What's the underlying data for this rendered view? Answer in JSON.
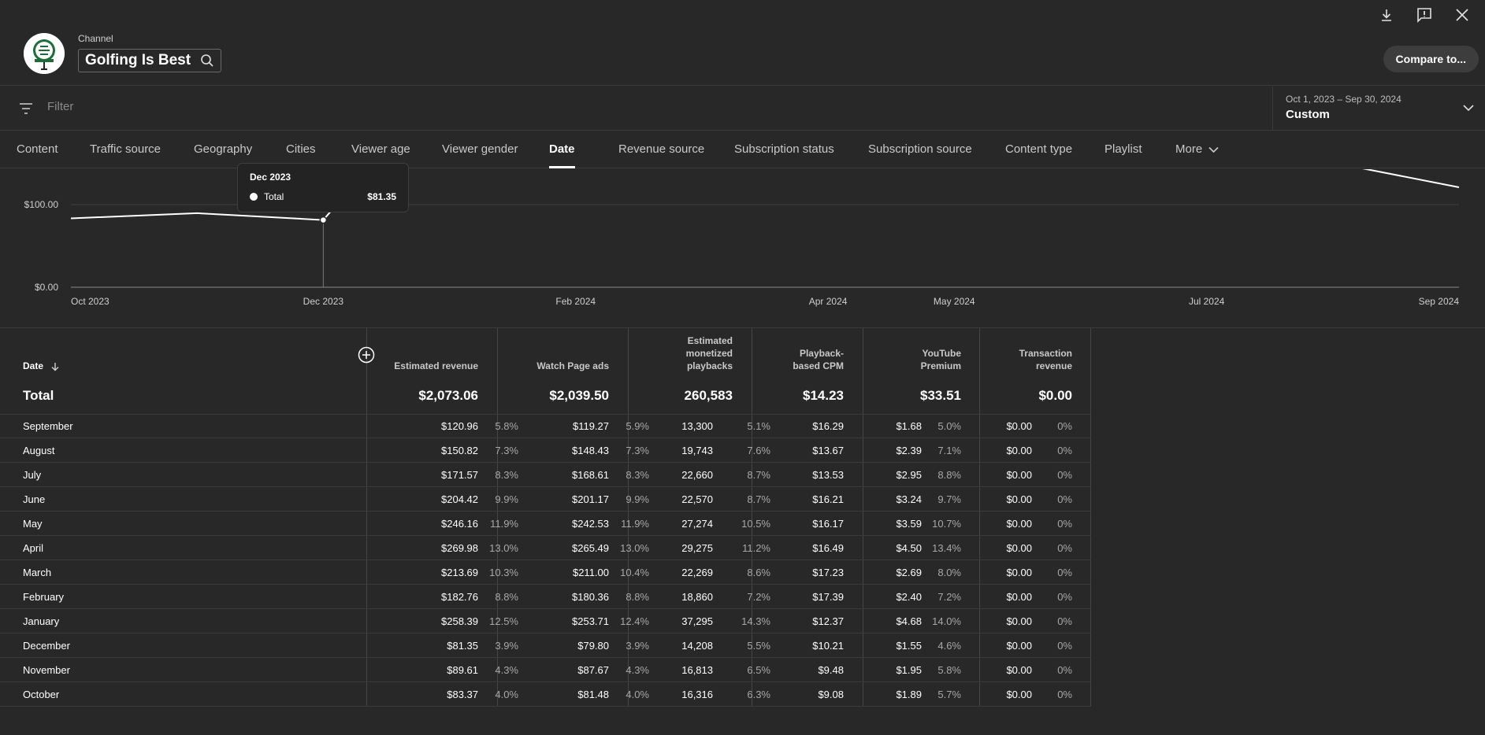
{
  "header": {
    "channel_label": "Channel",
    "channel_name": "Golfing Is Best",
    "compare_label": "Compare to..."
  },
  "filter": {
    "placeholder": "Filter",
    "date_range": "Oct 1, 2023 – Sep 30, 2024",
    "date_preset": "Custom"
  },
  "tabs": [
    {
      "label": "Content"
    },
    {
      "label": "Traffic source"
    },
    {
      "label": "Geography"
    },
    {
      "label": "Cities"
    },
    {
      "label": "Viewer age"
    },
    {
      "label": "Viewer gender"
    },
    {
      "label": "Date"
    },
    {
      "label": "Revenue source"
    },
    {
      "label": "Subscription status"
    },
    {
      "label": "Subscription source"
    },
    {
      "label": "Content type"
    },
    {
      "label": "Playlist"
    },
    {
      "label": "More"
    }
  ],
  "active_tab": "Date",
  "tooltip": {
    "date": "Dec 2023",
    "series": "Total",
    "value": "$81.35"
  },
  "chart_data": {
    "type": "line",
    "x": [
      "Oct 2023",
      "Nov 2023",
      "Dec 2023",
      "Jan 2024",
      "Feb 2024",
      "Mar 2024",
      "Apr 2024",
      "May 2024",
      "Jun 2024",
      "Jul 2024",
      "Aug 2024",
      "Sep 2024"
    ],
    "x_tick_labels": [
      "Oct 2023",
      "Dec 2023",
      "Feb 2024",
      "Apr 2024",
      "May 2024",
      "Jul 2024",
      "Sep 2024"
    ],
    "y_tick_labels": [
      "$100.00",
      "$0.00"
    ],
    "series": [
      {
        "name": "Total",
        "values": [
          83.37,
          89.61,
          81.35,
          258.39,
          182.76,
          213.69,
          269.98,
          246.16,
          204.42,
          171.57,
          150.82,
          120.96
        ]
      }
    ],
    "ylim": [
      0,
      120
    ],
    "highlight_x": "Dec 2023",
    "colors": {
      "line": "#ffffff",
      "grid": "#3e3e3e",
      "axis": "#9a9a9a"
    }
  },
  "table": {
    "date_header": "Date",
    "columns": [
      {
        "label": "Estimated revenue"
      },
      {
        "label": "Watch Page ads"
      },
      {
        "label": "Estimated monetized playbacks"
      },
      {
        "label": "Playback-based CPM"
      },
      {
        "label": "YouTube Premium"
      },
      {
        "label": "Transaction revenue"
      }
    ],
    "total_label": "Total",
    "totals": [
      "$2,073.06",
      "$2,039.50",
      "260,583",
      "$14.23",
      "$33.51",
      "$0.00"
    ],
    "rows": [
      {
        "label": "September",
        "rev": "$120.96",
        "rev_pct": "5.8%",
        "ads": "$119.27",
        "ads_pct": "5.9%",
        "mp": "13,300",
        "mp_pct": "5.1%",
        "cpm": "$16.29",
        "prem": "$1.68",
        "prem_pct": "5.0%",
        "tr": "$0.00",
        "tr_pct": "0%"
      },
      {
        "label": "August",
        "rev": "$150.82",
        "rev_pct": "7.3%",
        "ads": "$148.43",
        "ads_pct": "7.3%",
        "mp": "19,743",
        "mp_pct": "7.6%",
        "cpm": "$13.67",
        "prem": "$2.39",
        "prem_pct": "7.1%",
        "tr": "$0.00",
        "tr_pct": "0%"
      },
      {
        "label": "July",
        "rev": "$171.57",
        "rev_pct": "8.3%",
        "ads": "$168.61",
        "ads_pct": "8.3%",
        "mp": "22,660",
        "mp_pct": "8.7%",
        "cpm": "$13.53",
        "prem": "$2.95",
        "prem_pct": "8.8%",
        "tr": "$0.00",
        "tr_pct": "0%"
      },
      {
        "label": "June",
        "rev": "$204.42",
        "rev_pct": "9.9%",
        "ads": "$201.17",
        "ads_pct": "9.9%",
        "mp": "22,570",
        "mp_pct": "8.7%",
        "cpm": "$16.21",
        "prem": "$3.24",
        "prem_pct": "9.7%",
        "tr": "$0.00",
        "tr_pct": "0%"
      },
      {
        "label": "May",
        "rev": "$246.16",
        "rev_pct": "11.9%",
        "ads": "$242.53",
        "ads_pct": "11.9%",
        "mp": "27,274",
        "mp_pct": "10.5%",
        "cpm": "$16.17",
        "prem": "$3.59",
        "prem_pct": "10.7%",
        "tr": "$0.00",
        "tr_pct": "0%"
      },
      {
        "label": "April",
        "rev": "$269.98",
        "rev_pct": "13.0%",
        "ads": "$265.49",
        "ads_pct": "13.0%",
        "mp": "29,275",
        "mp_pct": "11.2%",
        "cpm": "$16.49",
        "prem": "$4.50",
        "prem_pct": "13.4%",
        "tr": "$0.00",
        "tr_pct": "0%"
      },
      {
        "label": "March",
        "rev": "$213.69",
        "rev_pct": "10.3%",
        "ads": "$211.00",
        "ads_pct": "10.4%",
        "mp": "22,269",
        "mp_pct": "8.6%",
        "cpm": "$17.23",
        "prem": "$2.69",
        "prem_pct": "8.0%",
        "tr": "$0.00",
        "tr_pct": "0%"
      },
      {
        "label": "February",
        "rev": "$182.76",
        "rev_pct": "8.8%",
        "ads": "$180.36",
        "ads_pct": "8.8%",
        "mp": "18,860",
        "mp_pct": "7.2%",
        "cpm": "$17.39",
        "prem": "$2.40",
        "prem_pct": "7.2%",
        "tr": "$0.00",
        "tr_pct": "0%"
      },
      {
        "label": "January",
        "rev": "$258.39",
        "rev_pct": "12.5%",
        "ads": "$253.71",
        "ads_pct": "12.4%",
        "mp": "37,295",
        "mp_pct": "14.3%",
        "cpm": "$12.37",
        "prem": "$4.68",
        "prem_pct": "14.0%",
        "tr": "$0.00",
        "tr_pct": "0%"
      },
      {
        "label": "December",
        "rev": "$81.35",
        "rev_pct": "3.9%",
        "ads": "$79.80",
        "ads_pct": "3.9%",
        "mp": "14,208",
        "mp_pct": "5.5%",
        "cpm": "$10.21",
        "prem": "$1.55",
        "prem_pct": "4.6%",
        "tr": "$0.00",
        "tr_pct": "0%"
      },
      {
        "label": "November",
        "rev": "$89.61",
        "rev_pct": "4.3%",
        "ads": "$87.67",
        "ads_pct": "4.3%",
        "mp": "16,813",
        "mp_pct": "6.5%",
        "cpm": "$9.48",
        "prem": "$1.95",
        "prem_pct": "5.8%",
        "tr": "$0.00",
        "tr_pct": "0%"
      },
      {
        "label": "October",
        "rev": "$83.37",
        "rev_pct": "4.0%",
        "ads": "$81.48",
        "ads_pct": "4.0%",
        "mp": "16,316",
        "mp_pct": "6.3%",
        "cpm": "$9.08",
        "prem": "$1.89",
        "prem_pct": "5.7%",
        "tr": "$0.00",
        "tr_pct": "0%"
      }
    ]
  }
}
